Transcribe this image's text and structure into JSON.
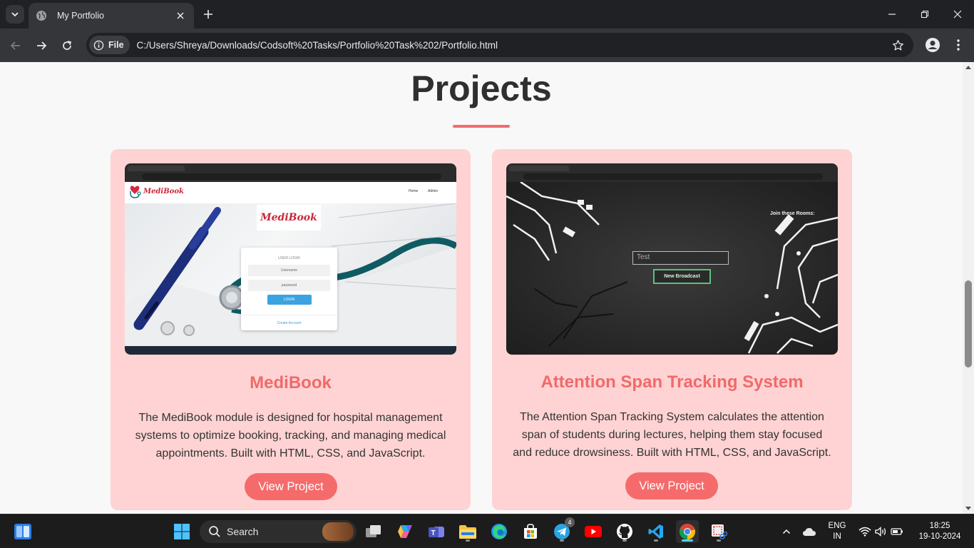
{
  "browser": {
    "tab_title": "My Portfolio",
    "site_chip": "File",
    "url": "C:/Users/Shreya/Downloads/Codsoft%20Tasks/Portfolio%20Task%202/Portfolio.html"
  },
  "page": {
    "section_title": "Projects",
    "projects": [
      {
        "title": "MediBook",
        "description": "The MediBook module is designed for hospital management systems to optimize booking, tracking, and managing medical appointments. Built with HTML, CSS, and JavaScript.",
        "button": "View Project",
        "screenshot": {
          "logo": "MediBook",
          "nav": [
            "Home",
            "Admin"
          ],
          "login_heading": "USER LOGIN",
          "username_placeholder": "Username",
          "password_placeholder": "password",
          "login_button": "LOGIN",
          "create_account": "Create Account"
        }
      },
      {
        "title": "Attention Span Tracking System",
        "description": "The Attention Span Tracking System calculates the attention span of students during lectures, helping them stay focused and reduce drowsiness. Built with HTML, CSS, and JavaScript.",
        "button": "View Project",
        "screenshot": {
          "join_label": "Join these Rooms:",
          "input_value": "Test",
          "button": "New Broadcast"
        }
      }
    ]
  },
  "taskbar": {
    "search_label": "Search",
    "telegram_badge": "4",
    "language": "ENG",
    "region": "IN",
    "time": "18:25",
    "date": "19-10-2024"
  },
  "colors": {
    "accent": "#f06a6a",
    "card_bg": "#ffd3d3",
    "button_bg": "#f56b6b"
  }
}
